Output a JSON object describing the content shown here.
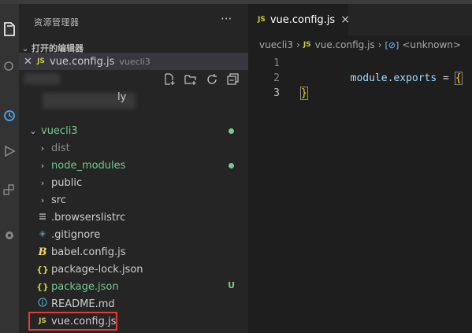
{
  "sidebar": {
    "title": "资源管理器",
    "more_label": "···",
    "open_editors": {
      "title": "打开的编辑器",
      "items": [
        {
          "icon": "JS",
          "label": "vue.config.js",
          "description": "vuecli3"
        }
      ]
    },
    "workspace_partial": "ly",
    "folder": {
      "name": "vuecli3",
      "items": [
        {
          "kind": "folder",
          "label": "dist",
          "style": "grey"
        },
        {
          "kind": "folder",
          "label": "node_modules",
          "style": "green",
          "decoration": "dot"
        },
        {
          "kind": "folder",
          "label": "public",
          "style": "normal"
        },
        {
          "kind": "folder",
          "label": "src",
          "style": "normal"
        },
        {
          "kind": "file",
          "icon": "lines",
          "label": ".browserslistrc",
          "style": "normal"
        },
        {
          "kind": "file",
          "icon": "git",
          "label": ".gitignore",
          "style": "normal"
        },
        {
          "kind": "file",
          "icon": "babel",
          "label": "babel.config.js",
          "style": "normal"
        },
        {
          "kind": "file",
          "icon": "json",
          "label": "package-lock.json",
          "style": "normal"
        },
        {
          "kind": "file",
          "icon": "json",
          "label": "package.json",
          "style": "green",
          "decoration": "U"
        },
        {
          "kind": "file",
          "icon": "info",
          "label": "README.md",
          "style": "normal"
        },
        {
          "kind": "file",
          "icon": "js",
          "label": "vue.config.js",
          "style": "normal",
          "highlighted": true
        }
      ]
    }
  },
  "editor": {
    "tab": {
      "icon": "JS",
      "label": "vue.config.js",
      "close": "×"
    },
    "breadcrumbs": [
      "vuecli3",
      "vue.config.js",
      "<unknown>"
    ],
    "lines": [
      {
        "num": "1",
        "tokens": [
          [
            "module",
            "var"
          ],
          [
            ".",
            "op"
          ],
          [
            "exports",
            "prop"
          ],
          [
            " = ",
            "op"
          ],
          [
            "{",
            "br"
          ]
        ]
      },
      {
        "num": "2",
        "tokens": []
      },
      {
        "num": "3",
        "tokens": [
          [
            "}",
            "br"
          ]
        ]
      }
    ]
  },
  "colors": {
    "accent_green": "#73c991",
    "js_yellow": "#cbcb41",
    "highlight_red": "#e53935"
  }
}
